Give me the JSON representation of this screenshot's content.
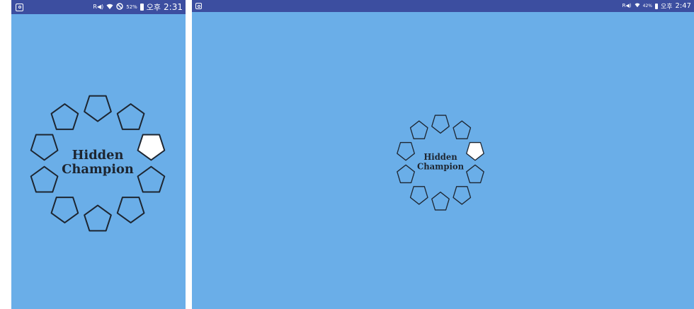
{
  "colors": {
    "background": "#6aaee8",
    "statusbar": "#3c4ea0",
    "outline": "#1d2530",
    "highlight": "#ffffff"
  },
  "phone": {
    "status": {
      "signal_label": "R◀)",
      "battery_percent": "52%",
      "ampm": "오후",
      "time": "2:31"
    },
    "logo": {
      "title_line1": "Hidden",
      "title_line2": "Champion",
      "highlighted_index": 2
    }
  },
  "tablet": {
    "status": {
      "signal_label": "R◀)",
      "battery_percent": "42%",
      "ampm": "오후",
      "time": "2:47"
    },
    "logo": {
      "title_line1": "Hidden",
      "title_line2": "Champion",
      "highlighted_index": 2
    }
  }
}
